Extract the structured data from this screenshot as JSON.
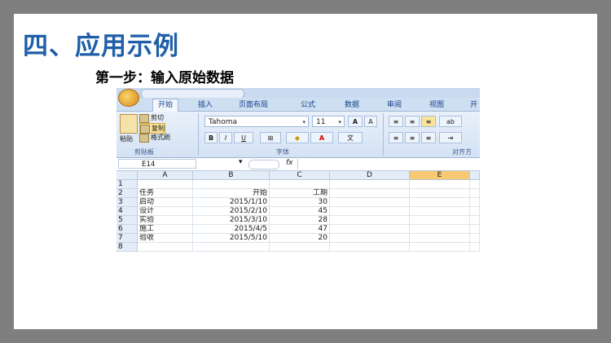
{
  "slide": {
    "title": "四、应用示例",
    "subtitle": "第一步：输入原始数据"
  },
  "excel": {
    "tabs": [
      "开始",
      "插入",
      "页面布局",
      "公式",
      "数据",
      "审阅",
      "视图",
      "开"
    ],
    "active_tab": "开始",
    "clipboard": {
      "paste_label": "粘贴",
      "cut_label": "剪切",
      "copy_label": "复制",
      "format_painter_label": "格式刷",
      "group_label": "剪贴板"
    },
    "font": {
      "name": "Tahoma",
      "size": "11",
      "group_label": "字体"
    },
    "alignment": {
      "group_label": "对齐方"
    },
    "name_box": "E14",
    "fx_label": "fx",
    "columns": [
      "A",
      "B",
      "C",
      "D",
      "E"
    ],
    "selected_column": "E",
    "row_numbers": [
      "1",
      "2",
      "3",
      "4",
      "5",
      "6",
      "7",
      "8"
    ],
    "rows": [
      [
        "",
        "",
        ""
      ],
      [
        "任务",
        "开始",
        "工期"
      ],
      [
        "启动",
        "2015/1/10",
        "30"
      ],
      [
        "设计",
        "2015/2/10",
        "45"
      ],
      [
        "实验",
        "2015/3/10",
        "28"
      ],
      [
        "施工",
        "2015/4/5",
        "47"
      ],
      [
        "验收",
        "2015/5/10",
        "20"
      ],
      [
        "",
        "",
        ""
      ]
    ]
  }
}
